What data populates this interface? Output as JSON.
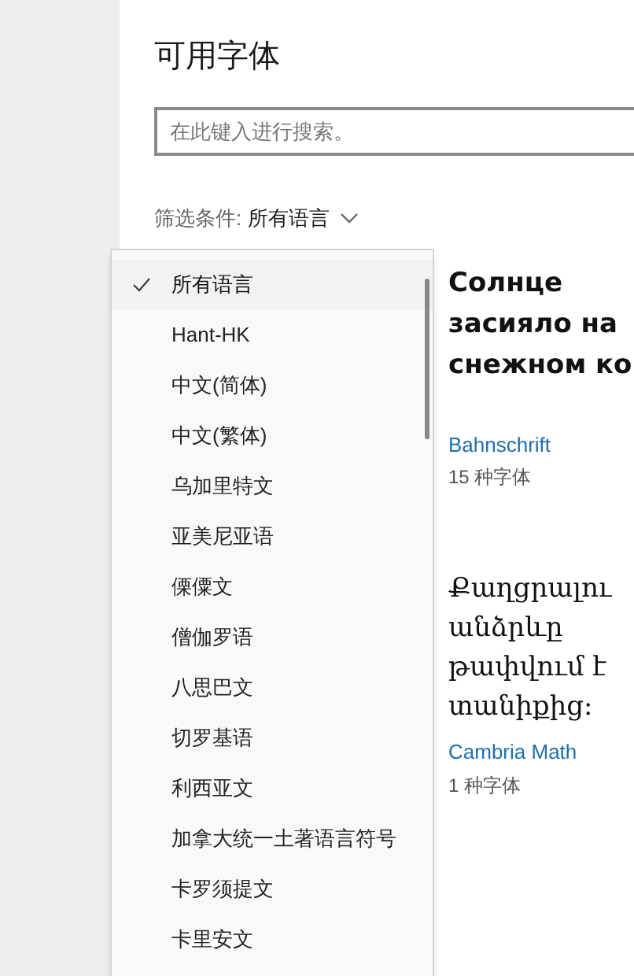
{
  "title": "可用字体",
  "search": {
    "placeholder": "在此键入进行搜索。"
  },
  "filter": {
    "label": "筛选条件:",
    "value": "所有语言"
  },
  "dropdown": {
    "items": [
      {
        "label": "所有语言",
        "selected": true
      },
      {
        "label": "Hant-HK",
        "selected": false
      },
      {
        "label": "中文(简体)",
        "selected": false
      },
      {
        "label": "中文(繁体)",
        "selected": false
      },
      {
        "label": "乌加里特文",
        "selected": false
      },
      {
        "label": "亚美尼亚语",
        "selected": false
      },
      {
        "label": "傈僳文",
        "selected": false
      },
      {
        "label": "僧伽罗语",
        "selected": false
      },
      {
        "label": "八思巴文",
        "selected": false
      },
      {
        "label": "切罗基语",
        "selected": false
      },
      {
        "label": "利西亚文",
        "selected": false
      },
      {
        "label": "加拿大统一土著语言符号",
        "selected": false
      },
      {
        "label": "卡罗须提文",
        "selected": false
      },
      {
        "label": "卡里安文",
        "selected": false
      }
    ]
  },
  "fonts": [
    {
      "sample": [
        "Солнце",
        "засияло на",
        "снежном ко"
      ],
      "name": "Bahnschrift",
      "count": "15 种字体",
      "kind": "sans"
    },
    {
      "sample": [
        "Քաղցրալու",
        "անձրևը",
        "թափվում է",
        "տանիքից:"
      ],
      "name": "Cambria Math",
      "count": "1 种字体",
      "kind": "serif"
    }
  ]
}
